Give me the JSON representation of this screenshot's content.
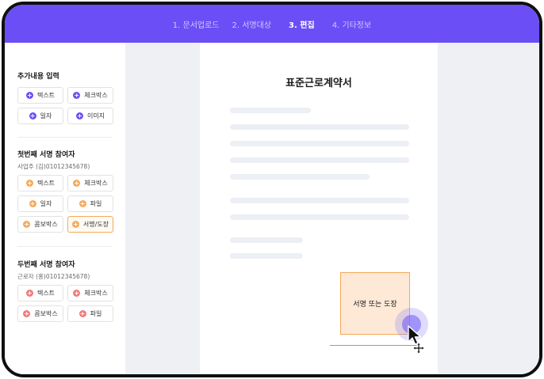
{
  "steps": [
    {
      "label": "1. 문서업로드",
      "active": false
    },
    {
      "label": "2. 서명대상",
      "active": false
    },
    {
      "label": "3. 편집",
      "active": true
    },
    {
      "label": "4. 기타정보",
      "active": false
    }
  ],
  "sidebar": {
    "section1": {
      "title": "추가내용 입력",
      "buttons": [
        "텍스트",
        "체크박스",
        "일자",
        "이미지"
      ]
    },
    "section2": {
      "title": "첫번째 서명 참여자",
      "subtitle": "사업주 (김)01012345678)",
      "buttons": [
        "텍스트",
        "체크박스",
        "일자",
        "파일",
        "콤보박스",
        "서명/도장"
      ],
      "selected": "서명/도장"
    },
    "section3": {
      "title": "두번째 서명 참여자",
      "subtitle": "근로자 (홍)01012345678)",
      "buttons": [
        "텍스트",
        "체크박스",
        "콤보박스",
        "파일"
      ]
    }
  },
  "document": {
    "title": "표준근로계약서",
    "signature_box": "서명 또는 도장"
  },
  "colors": {
    "accent": "#6b4ef6",
    "participant1": "#f4a95b",
    "participant2": "#ef7a7a"
  },
  "icons": {
    "add": "plus-icon",
    "cursor": "arrow-cursor-icon",
    "move": "move-icon"
  }
}
